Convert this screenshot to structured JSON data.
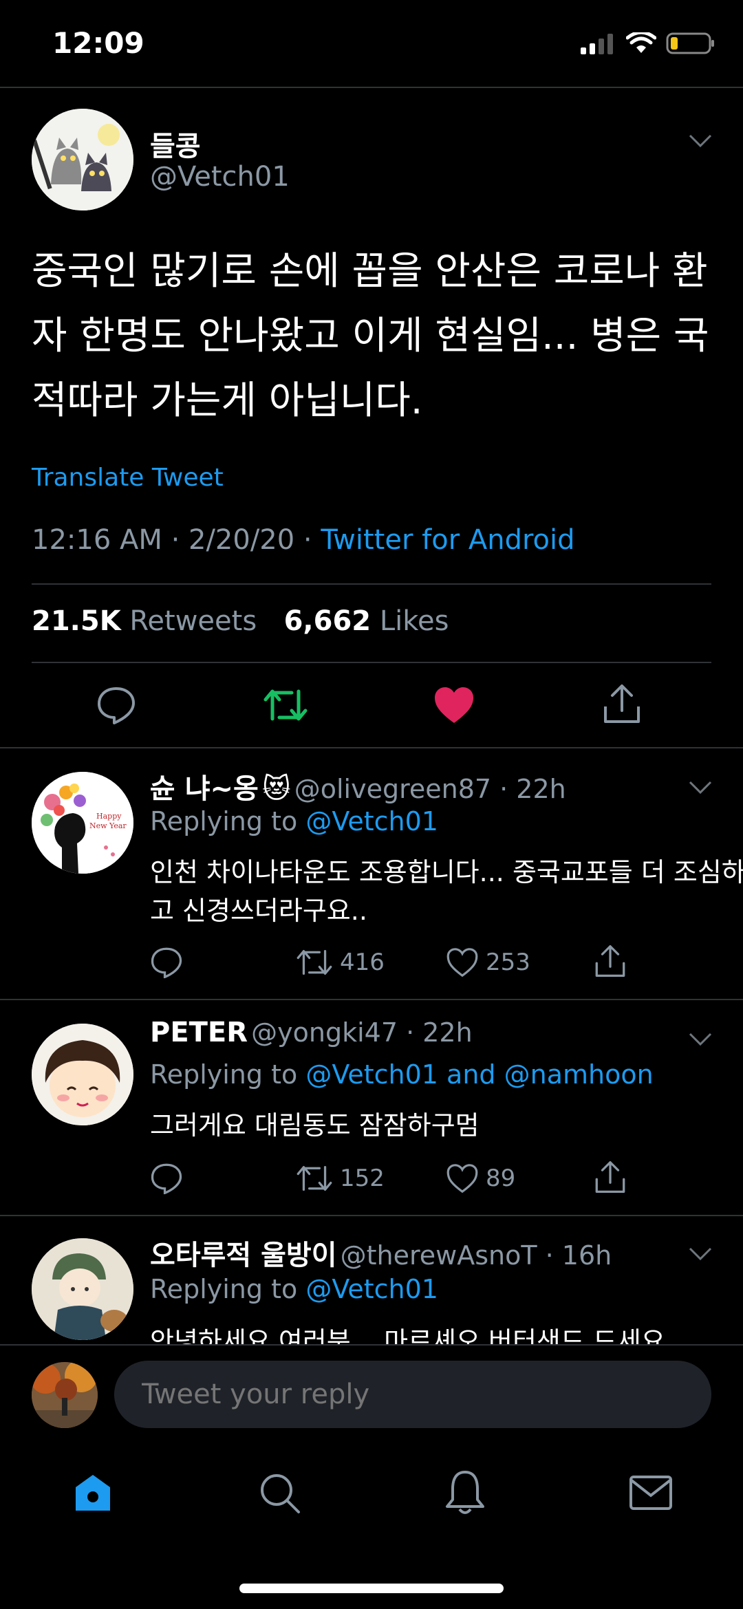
{
  "status": {
    "time": "12:09"
  },
  "main_tweet": {
    "name": "들콩",
    "handle": "@Vetch01",
    "text": "중국인 많기로 손에 꼽을 안산은 코로나 환자 한명도 안나왔고 이게 현실임... 병은 국적따라 가는게 아닙니다.",
    "translate": "Translate Tweet",
    "time": "12:16 AM · 2/20/20 · ",
    "source": "Twitter for Android",
    "retweets_count": "21.5K",
    "retweets_label": "Retweets",
    "likes_count": "6,662",
    "likes_label": "Likes"
  },
  "replies": [
    {
      "name": "슌 냐~옹",
      "emoji": "😻",
      "handle_time": "@olivegreen87 · 22h",
      "replying_label": "Replying to ",
      "replying_to": "@Vetch01",
      "text": "인천 차이나타운도 조용합니다... 중국교포들 더 조심하고 신경쓰더라구요..",
      "retweets": "416",
      "likes": "253"
    },
    {
      "name": "PETER",
      "handle_time": "@yongki47 · 22h",
      "replying_label": "Replying to ",
      "replying_to": "@Vetch01 and @namhoon",
      "text": "그러게요 대림동도 잠잠하구멈",
      "retweets": "152",
      "likes": "89"
    },
    {
      "name": "오타루적 울방이",
      "handle_time": "@therewAsnoT · 16h",
      "replying_label": "Replying to ",
      "replying_to": "@Vetch01",
      "text": "안녕하세요 여러분... 마르셰오 버터샌드 드세요"
    }
  ],
  "reply_bar": {
    "placeholder": "Tweet your reply"
  },
  "tab_bar": {
    "items": [
      "home",
      "search",
      "notifications",
      "messages"
    ]
  },
  "colors": {
    "accent": "#1d9bf0",
    "retweet": "#17bf63",
    "like": "#e0245e",
    "background": "#000000"
  }
}
